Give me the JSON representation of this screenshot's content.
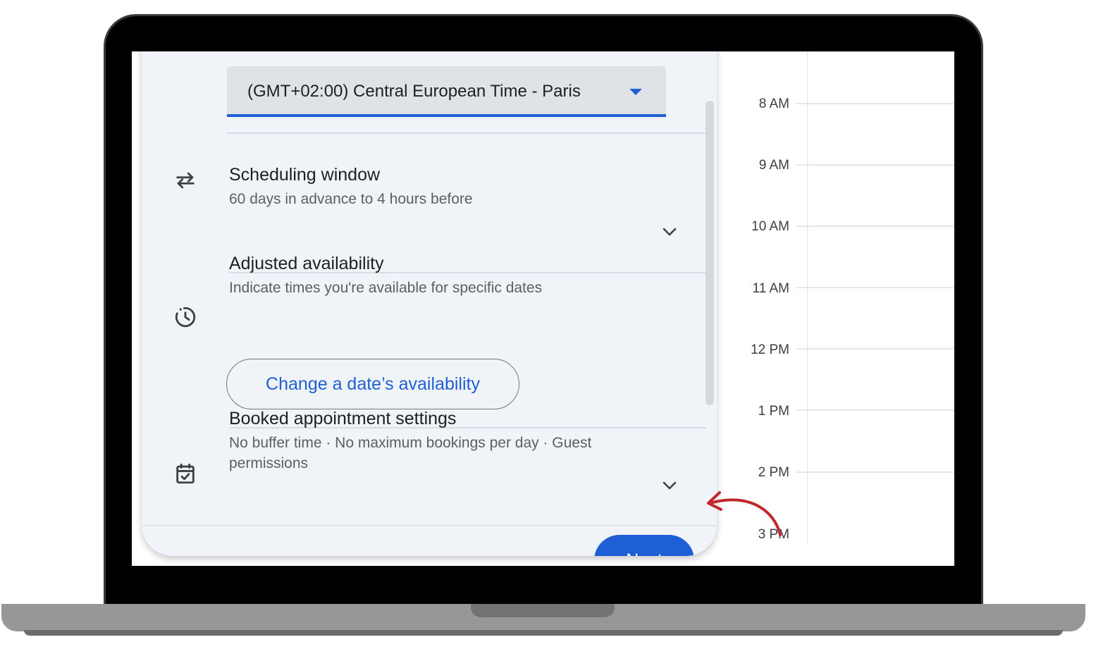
{
  "timezone": {
    "selected": "(GMT+02:00) Central European Time - Paris"
  },
  "sections": [
    {
      "icon": "swap-arrows-icon",
      "title": "Scheduling window",
      "subtitle": "60 days in advance to 4 hours before",
      "expandable": true
    },
    {
      "icon": "history-clock-icon",
      "title": "Adjusted availability",
      "subtitle": "Indicate times you're available for specific dates",
      "action_label": "Change a date’s availability"
    },
    {
      "icon": "calendar-check-icon",
      "title": "Booked appointment settings",
      "subtitle_line1": "No buffer time · No maximum bookings per day · Guest",
      "subtitle_line2": "permissions",
      "expandable": true
    }
  ],
  "footer": {
    "next_label": "Next"
  },
  "calendar": {
    "times": [
      "8 AM",
      "9 AM",
      "10 AM",
      "11 AM",
      "12 PM",
      "1 PM",
      "2 PM",
      "3 PM"
    ]
  },
  "colors": {
    "accent": "#1f5fd6",
    "panel_bg": "#f0f4f9",
    "annotation_arrow": "#c0262c"
  }
}
